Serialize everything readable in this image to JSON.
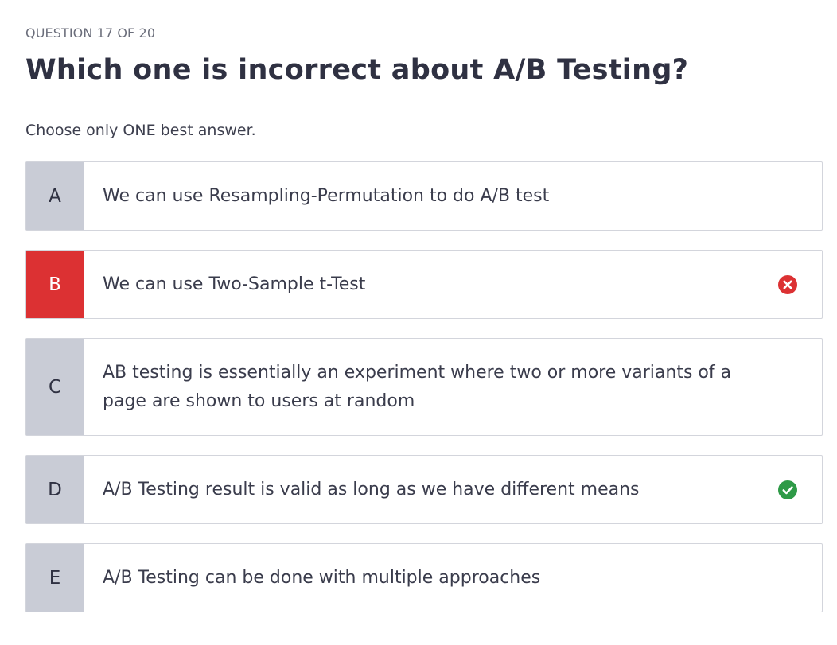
{
  "quiz": {
    "counter": "QUESTION 17 OF 20",
    "question": "Which one is incorrect about A/B Testing?",
    "instruction": "Choose only ONE best answer."
  },
  "options": [
    {
      "letter": "A",
      "text": "We can use Resampling-Permutation to do A/B test",
      "state": "none"
    },
    {
      "letter": "B",
      "text": "We can use Two-Sample t-Test",
      "state": "wrong",
      "icon": "x-circle-icon",
      "color": "#dc3133"
    },
    {
      "letter": "C",
      "text": "AB testing is essentially an experiment where two or more variants of a page are shown to users at random",
      "state": "none"
    },
    {
      "letter": "D",
      "text": "A/B Testing result is valid as long as we have different means",
      "state": "correct",
      "icon": "check-circle-icon",
      "color": "#2e9a47"
    },
    {
      "letter": "E",
      "text": "A/B Testing can be done with multiple approaches",
      "state": "none"
    }
  ]
}
